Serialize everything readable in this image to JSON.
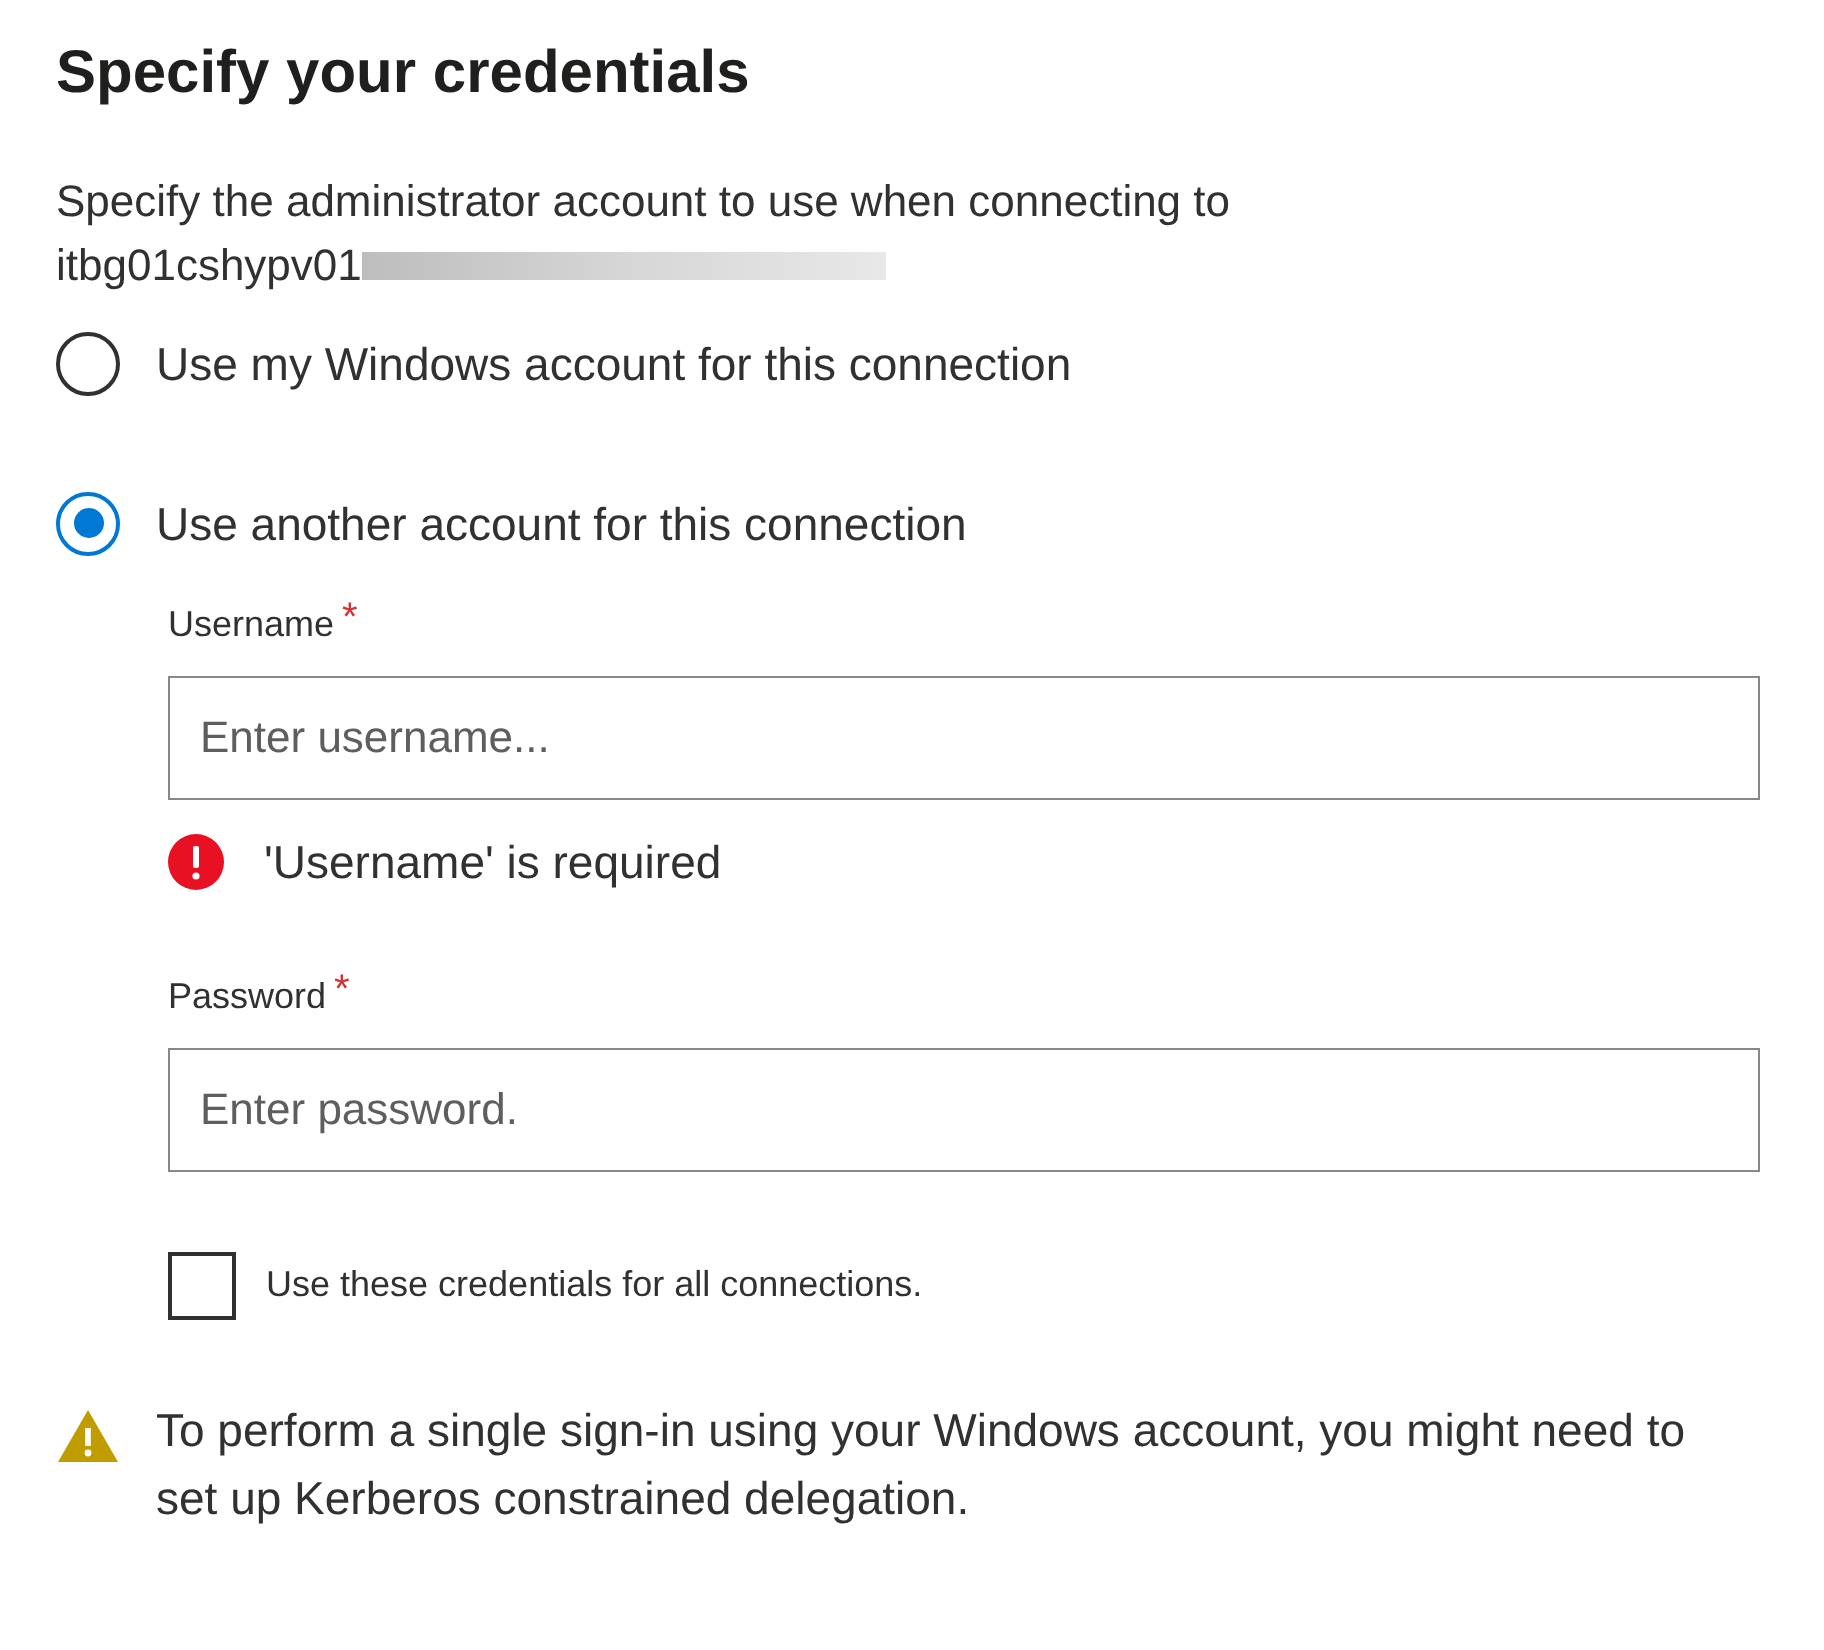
{
  "title": "Specify your credentials",
  "description": "Specify the administrator account to use when connecting to",
  "server_name": "itbg01cshypv01",
  "options": [
    {
      "label": "Use my Windows account for this connection",
      "selected": false
    },
    {
      "label": "Use another account for this connection",
      "selected": true
    }
  ],
  "username": {
    "label": "Username",
    "required_mark": "*",
    "placeholder": "Enter username...",
    "error": "'Username' is required"
  },
  "password": {
    "label": "Password",
    "required_mark": "*",
    "placeholder": "Enter password."
  },
  "remember": {
    "label": "Use these credentials for all connections.",
    "checked": false
  },
  "warning": "To perform a single sign-in using your Windows account, you might need to set up Kerberos constrained delegation."
}
